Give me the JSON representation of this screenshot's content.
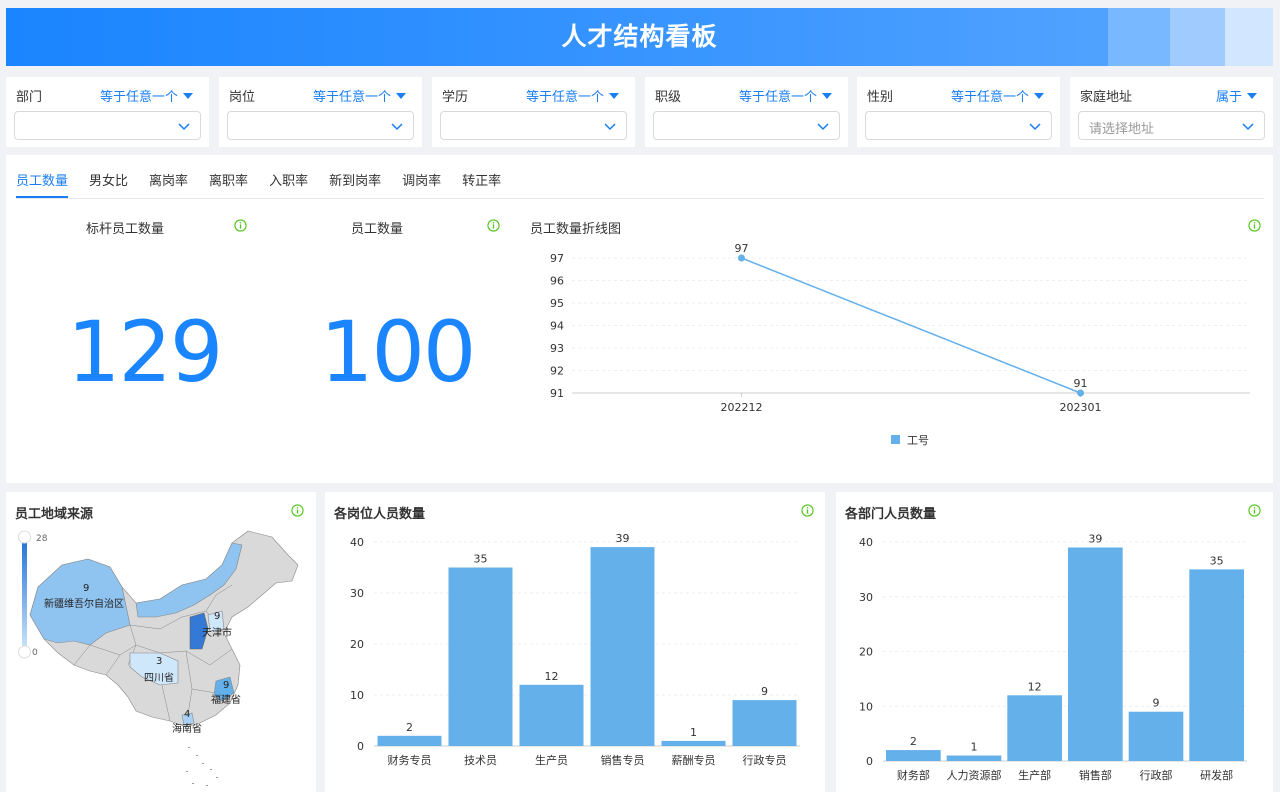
{
  "header": {
    "title": "人才结构看板"
  },
  "filters": [
    {
      "label": "部门",
      "operator": "等于任意一个",
      "placeholder": ""
    },
    {
      "label": "岗位",
      "operator": "等于任意一个",
      "placeholder": ""
    },
    {
      "label": "学历",
      "operator": "等于任意一个",
      "placeholder": ""
    },
    {
      "label": "职级",
      "operator": "等于任意一个",
      "placeholder": ""
    },
    {
      "label": "性别",
      "operator": "等于任意一个",
      "placeholder": ""
    },
    {
      "label": "家庭地址",
      "operator": "属于",
      "placeholder": "请选择地址"
    }
  ],
  "tabs": [
    "员工数量",
    "男女比",
    "离岗率",
    "离职率",
    "入职率",
    "新到岗率",
    "调岗率",
    "转正率"
  ],
  "kpis": {
    "benchmark": {
      "title": "标杆员工数量",
      "value": "129"
    },
    "employees": {
      "title": "员工数量",
      "value": "100"
    }
  },
  "colors": {
    "accent": "#1a85ff",
    "bar": "#64b0ea",
    "info": "#52c41a"
  },
  "chart_data": [
    {
      "type": "line",
      "title": "员工数量折线图",
      "x": [
        "202212",
        "202301"
      ],
      "series": [
        {
          "name": "工号",
          "values": [
            97,
            91
          ]
        }
      ],
      "yticks": [
        91,
        92,
        93,
        94,
        95,
        96,
        97
      ],
      "ylim": [
        91,
        97
      ],
      "legend": "bottom-center",
      "grid": true
    },
    {
      "type": "bar",
      "title": "各岗位人员数量",
      "categories": [
        "财务专员",
        "技术员",
        "生产员",
        "销售专员",
        "薪酬专员",
        "行政专员"
      ],
      "values": [
        2,
        35,
        12,
        39,
        1,
        9
      ],
      "yticks": [
        0,
        10,
        20,
        30,
        40
      ],
      "ylim": [
        0,
        40
      ]
    },
    {
      "type": "bar",
      "title": "各部门人员数量",
      "categories": [
        "财务部",
        "人力资源部",
        "生产部",
        "销售部",
        "行政部",
        "研发部"
      ],
      "values": [
        2,
        1,
        12,
        39,
        9,
        35
      ],
      "yticks": [
        0,
        10,
        20,
        30,
        40
      ],
      "ylim": [
        0,
        40
      ]
    }
  ],
  "map": {
    "title": "员工地域来源",
    "scale_max": "28",
    "scale_min": "0",
    "regions": [
      {
        "name": "新疆维吾尔自治区",
        "value": "9"
      },
      {
        "name": "天津市",
        "value": "9"
      },
      {
        "name": "四川省",
        "value": "3"
      },
      {
        "name": "福建省",
        "value": "9"
      },
      {
        "name": "海南省",
        "value": "4"
      }
    ]
  }
}
